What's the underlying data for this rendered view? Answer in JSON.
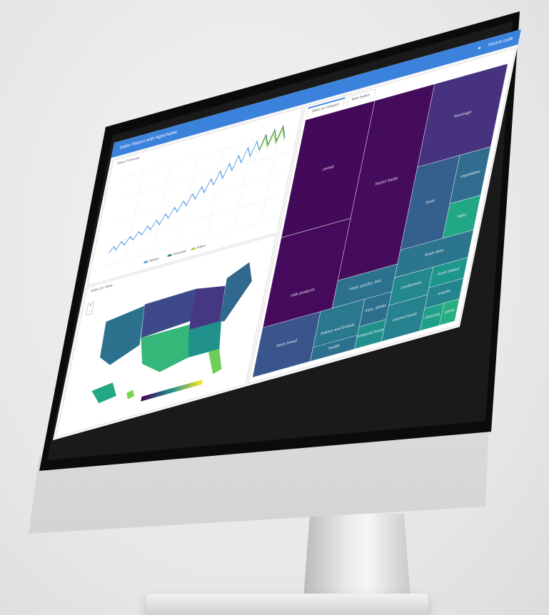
{
  "header": {
    "title": "Sales Report with highcharter",
    "share_icon": "share-icon",
    "source_code_label": "Source code"
  },
  "line_panel": {
    "title": "Sales Forecast",
    "legend": [
      "Series",
      "Forecast",
      "Fitted"
    ]
  },
  "map_panel": {
    "title": "Sales by State",
    "zoom_in": "+",
    "zoom_out": "-"
  },
  "treemap_panel": {
    "tabs": [
      "Sales by Category",
      "Best Sellers"
    ],
    "cells": [
      {
        "label": "cereal",
        "color": "#440a5a"
      },
      {
        "label": "frozen foods",
        "color": "#450c5c"
      },
      {
        "label": "beverage",
        "color": "#46327e"
      },
      {
        "label": "milk products",
        "color": "#450a5b"
      },
      {
        "label": "fruits",
        "color": "#355f8d"
      },
      {
        "label": "vegetables",
        "color": "#2f6c8e"
      },
      {
        "label": "fresh dairy",
        "color": "#2b758e"
      },
      {
        "label": "meat, poultry, fish",
        "color": "#2c728e"
      },
      {
        "label": "condiments",
        "color": "#23898e"
      },
      {
        "label": "fresh baked",
        "color": "#1f968b"
      },
      {
        "label": "fresh bread",
        "color": "#3a548c"
      },
      {
        "label": "bakery and breads",
        "color": "#2a788e"
      },
      {
        "label": "misc. drinks",
        "color": "#2e6f8e"
      },
      {
        "label": "snacks",
        "color": "#25858e"
      },
      {
        "label": "prepared foods",
        "color": "#21908d"
      },
      {
        "label": "canned foods",
        "color": "#26828e"
      },
      {
        "label": "cleaning",
        "color": "#1fa088"
      },
      {
        "label": "pasta",
        "color": "#28ae80"
      },
      {
        "label": "baby",
        "color": "#22a785"
      },
      {
        "label": "health",
        "color": "#2c718e"
      }
    ]
  },
  "colors": {
    "accent": "#3b82dc",
    "series": "#5b9be3",
    "forecast": "#2e8b57",
    "fitted": "#9acd32"
  }
}
